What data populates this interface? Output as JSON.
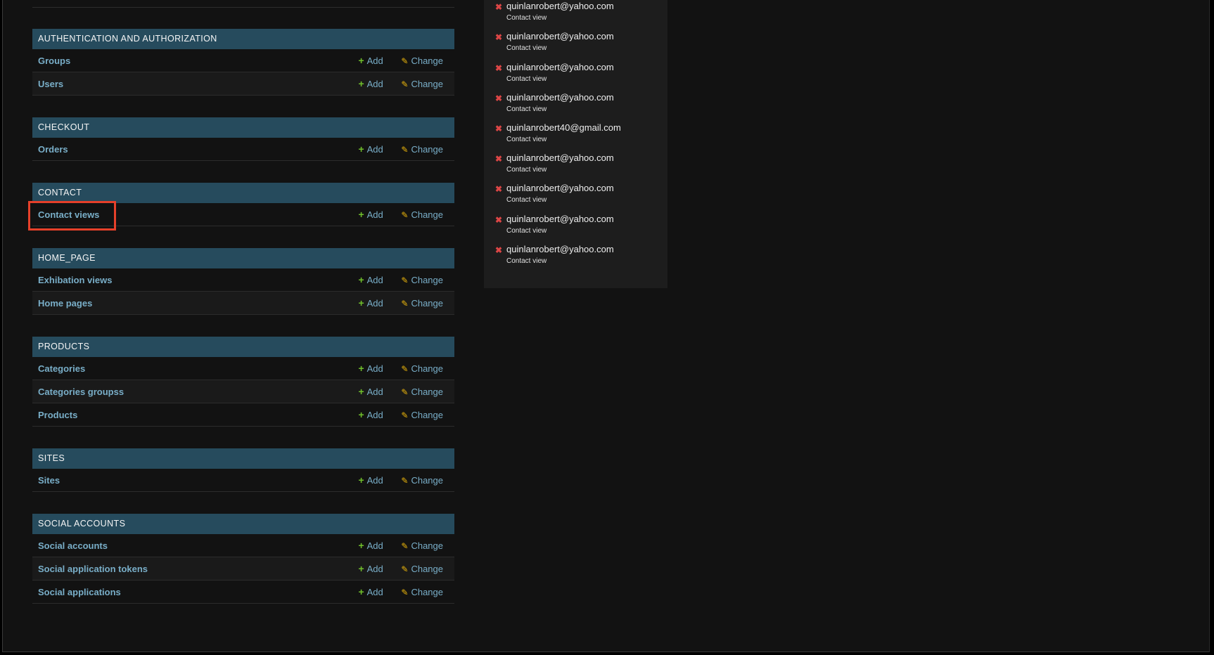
{
  "top_row": {
    "chevron": "⌃"
  },
  "modules": [
    {
      "caption": "AUTHENTICATION AND AUTHORIZATION",
      "models": [
        {
          "name": "Groups"
        },
        {
          "name": "Users"
        }
      ]
    },
    {
      "caption": "CHECKOUT",
      "models": [
        {
          "name": "Orders"
        }
      ]
    },
    {
      "caption": "CONTACT",
      "models": [
        {
          "name": "Contact views"
        }
      ]
    },
    {
      "caption": "HOME_PAGE",
      "models": [
        {
          "name": "Exhibation views"
        },
        {
          "name": "Home pages"
        }
      ]
    },
    {
      "caption": "PRODUCTS",
      "models": [
        {
          "name": "Categories"
        },
        {
          "name": "Categories groupss"
        },
        {
          "name": "Products"
        }
      ]
    },
    {
      "caption": "SITES",
      "models": [
        {
          "name": "Sites"
        }
      ]
    },
    {
      "caption": "SOCIAL ACCOUNTS",
      "models": [
        {
          "name": "Social accounts"
        },
        {
          "name": "Social application tokens"
        },
        {
          "name": "Social applications"
        }
      ]
    }
  ],
  "actions": {
    "add_label": "Add",
    "change_label": "Change",
    "add_icon": "plus-icon",
    "change_icon": "pencil-icon"
  },
  "highlighted_model": "Contact views",
  "recent_actions": [
    {
      "email": "quinlanrobert@yahoo.com",
      "type": "Contact view",
      "action": "deletion"
    },
    {
      "email": "quinlanrobert@yahoo.com",
      "type": "Contact view",
      "action": "deletion"
    },
    {
      "email": "quinlanrobert@yahoo.com",
      "type": "Contact view",
      "action": "deletion"
    },
    {
      "email": "quinlanrobert@yahoo.com",
      "type": "Contact view",
      "action": "deletion"
    },
    {
      "email": "quinlanrobert40@gmail.com",
      "type": "Contact view",
      "action": "deletion"
    },
    {
      "email": "quinlanrobert@yahoo.com",
      "type": "Contact view",
      "action": "deletion"
    },
    {
      "email": "quinlanrobert@yahoo.com",
      "type": "Contact view",
      "action": "deletion"
    },
    {
      "email": "quinlanrobert@yahoo.com",
      "type": "Contact view",
      "action": "deletion"
    },
    {
      "email": "quinlanrobert@yahoo.com",
      "type": "Contact view",
      "action": "deletion"
    }
  ],
  "colors": {
    "caption_bg": "#264b5d",
    "link": "#79aec8",
    "add_icon": "#70bf2b",
    "change_icon": "#efb80b",
    "delete_icon": "#dd4646",
    "highlight_box": "#e6402a"
  }
}
